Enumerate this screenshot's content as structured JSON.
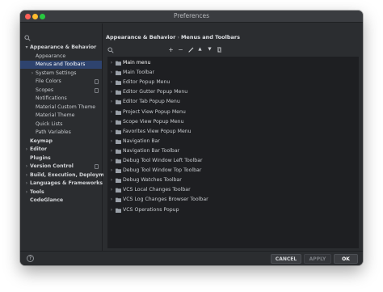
{
  "window": {
    "title": "Preferences"
  },
  "sidebar": {
    "search_icon": "search-icon",
    "items": [
      {
        "label": "Appearance & Behavior",
        "expanded": true,
        "has_arrow": true,
        "bold": true,
        "selected": false,
        "has_copy": false
      },
      {
        "label": "Appearance",
        "has_arrow": false,
        "bold": false,
        "selected": false,
        "has_copy": false
      },
      {
        "label": "Menus and Toolbars",
        "has_arrow": false,
        "bold": false,
        "selected": true,
        "has_copy": false
      },
      {
        "label": "System Settings",
        "expanded": false,
        "has_arrow": true,
        "bold": false,
        "selected": false,
        "has_copy": false
      },
      {
        "label": "File Colors",
        "has_arrow": false,
        "bold": false,
        "selected": false,
        "has_copy": true
      },
      {
        "label": "Scopes",
        "has_arrow": false,
        "bold": false,
        "selected": false,
        "has_copy": true
      },
      {
        "label": "Notifications",
        "has_arrow": false,
        "bold": false,
        "selected": false,
        "has_copy": false
      },
      {
        "label": "Material Custom Theme",
        "has_arrow": false,
        "bold": false,
        "selected": false,
        "has_copy": false
      },
      {
        "label": "Material Theme",
        "has_arrow": false,
        "bold": false,
        "selected": false,
        "has_copy": false
      },
      {
        "label": "Quick Lists",
        "has_arrow": false,
        "bold": false,
        "selected": false,
        "has_copy": false
      },
      {
        "label": "Path Variables",
        "has_arrow": false,
        "bold": false,
        "selected": false,
        "has_copy": false
      },
      {
        "label": "Keymap",
        "has_arrow": false,
        "bold": true,
        "selected": false,
        "has_copy": false
      },
      {
        "label": "Editor",
        "expanded": false,
        "has_arrow": true,
        "bold": true,
        "selected": false,
        "has_copy": false
      },
      {
        "label": "Plugins",
        "has_arrow": false,
        "bold": true,
        "selected": false,
        "has_copy": false
      },
      {
        "label": "Version Control",
        "expanded": false,
        "has_arrow": true,
        "bold": true,
        "selected": false,
        "has_copy": true
      },
      {
        "label": "Build, Execution, Deployment",
        "expanded": false,
        "has_arrow": true,
        "bold": true,
        "selected": false,
        "has_copy": false
      },
      {
        "label": "Languages & Frameworks",
        "expanded": false,
        "has_arrow": true,
        "bold": true,
        "selected": false,
        "has_copy": false
      },
      {
        "label": "Tools",
        "expanded": false,
        "has_arrow": true,
        "bold": true,
        "selected": false,
        "has_copy": false
      },
      {
        "label": "CodeGlance",
        "has_arrow": false,
        "bold": true,
        "selected": false,
        "has_copy": false
      }
    ]
  },
  "content": {
    "breadcrumb": {
      "parent": "Appearance & Behavior",
      "separator": "›",
      "current": "Menus and Toolbars"
    },
    "toolbar": {
      "search_icon": "search-icon",
      "add": "+",
      "remove": "−",
      "edit_icon": "pencil-icon",
      "move_up": "▲",
      "move_down": "▼",
      "restore_icon": "restore-icon"
    },
    "tree": [
      "Main menu",
      "Main Toolbar",
      "Editor Popup Menu",
      "Editor Gutter Popup Menu",
      "Editor Tab Popup Menu",
      "Project View Popup Menu",
      "Scope View Popup Menu",
      "Favorites View Popup Menu",
      "Navigation Bar",
      "Navigation Bar Toolbar",
      "Debug Tool Window Left Toolbar",
      "Debug Tool Window Top Toolbar",
      "Debug Watches Toolbar",
      "VCS Local Changes Toolbar",
      "VCS Log Changes Browser Toolbar",
      "VCS Operations Popup"
    ]
  },
  "footer": {
    "help": "?",
    "cancel": "CANCEL",
    "apply": "APPLY",
    "ok": "OK"
  },
  "colors": {
    "window_bg": "#2b2d30",
    "list_bg": "#1e1f22",
    "selection": "#2e436e",
    "folder": "#9aa0a8"
  }
}
